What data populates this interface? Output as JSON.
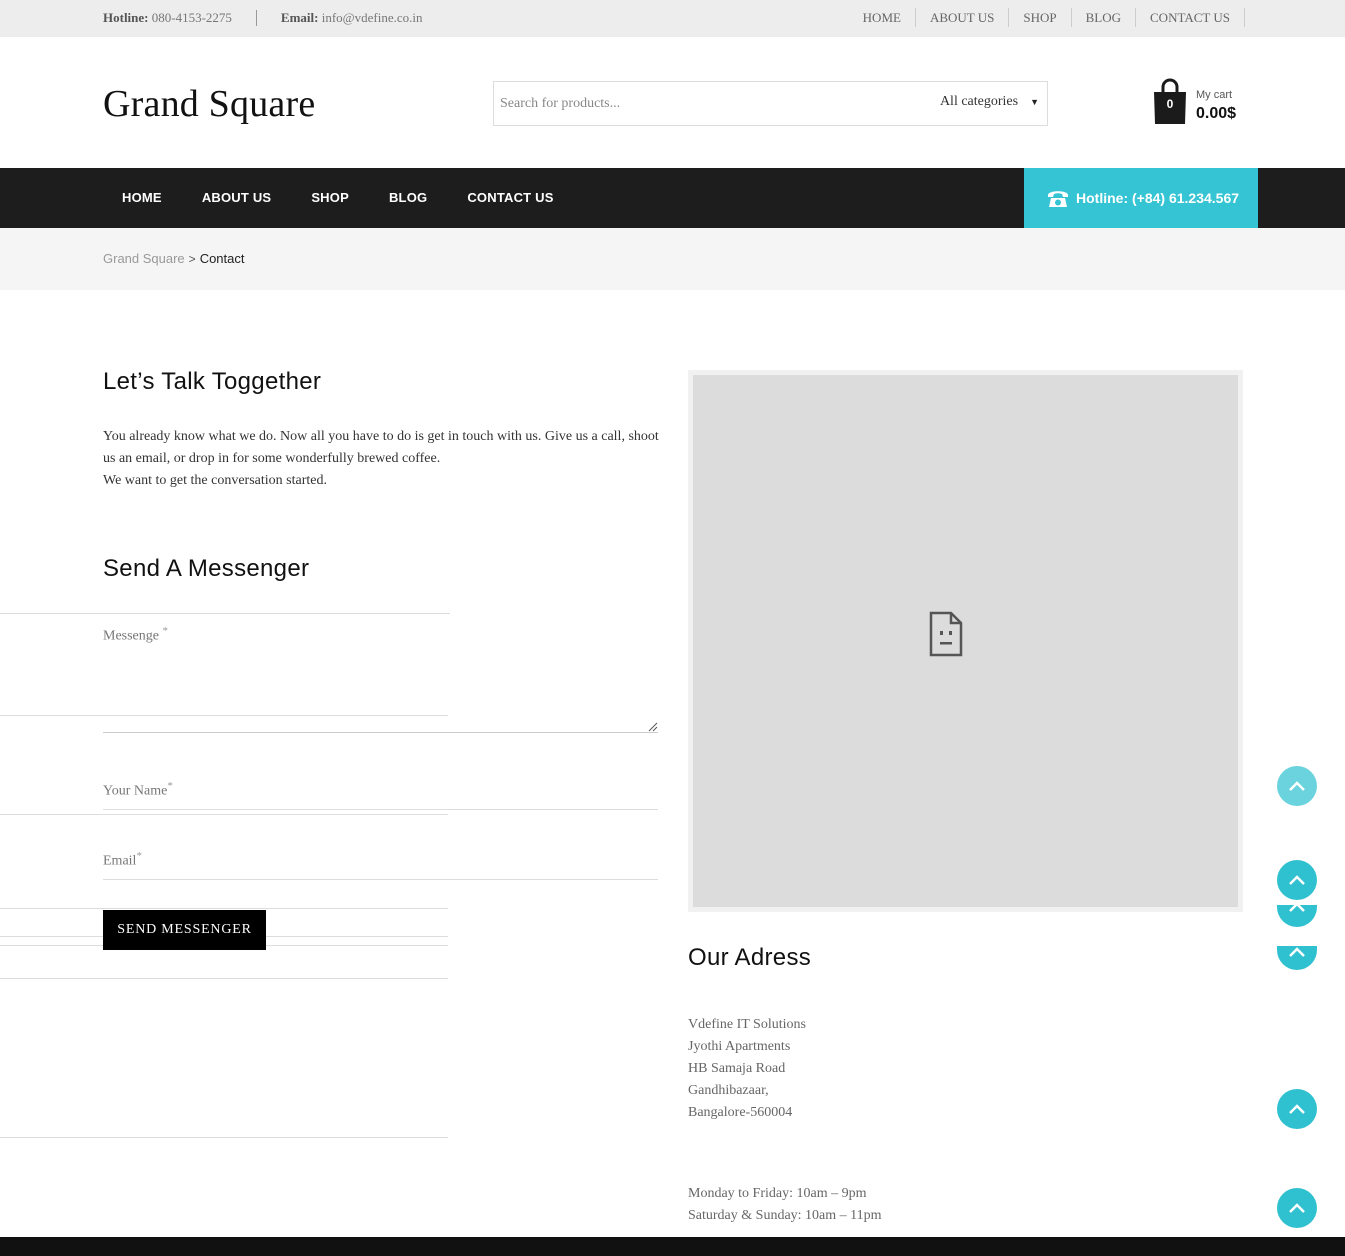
{
  "topbar": {
    "hotline_label": "Hotline:",
    "hotline_value": "080-4153-2275",
    "email_label": "Email:",
    "email_value": "info@vdefine.co.in",
    "nav": [
      "HOME",
      "ABOUT US",
      "SHOP",
      "BLOG",
      "CONTACT US"
    ]
  },
  "header": {
    "logo": "Grand Square",
    "search_placeholder": "Search for products...",
    "category": "All categories",
    "cart_count": "0",
    "cart_label": "My cart",
    "cart_total": "0.00$"
  },
  "mainnav": {
    "items": [
      "HOME",
      "ABOUT US",
      "SHOP",
      "BLOG",
      "CONTACT US"
    ],
    "hotline": "Hotline: (+84) 61.234.567"
  },
  "breadcrumb": {
    "home": "Grand Square",
    "separator": ">",
    "current": "Contact"
  },
  "intro": {
    "title": "Let’s Talk Toggether",
    "line1": "You already know what we do. Now all you have to do is get in touch with us. Give us a call, shoot us an email, or drop in for some wonderfully brewed coffee.",
    "line2": "We want to get the conversation started."
  },
  "form": {
    "title": "Send A Messenger",
    "message_label": "Messenge",
    "name_label": "Your Name",
    "email_label": "Email",
    "required_mark": "*",
    "submit": "SEND MESSENGER"
  },
  "address": {
    "title": "Our Adress",
    "lines": [
      "Vdefine IT Solutions",
      "Jyothi Apartments",
      "HB Samaja Road",
      "Gandhibazaar,",
      "Bangalore-560004"
    ]
  },
  "hours": {
    "lines": [
      "Monday to Friday: 10am – 9pm",
      "Saturday & Sunday: 10am – 11pm"
    ]
  },
  "colors": {
    "accent": "#35c4d3",
    "nav_bg": "#1d1d1d",
    "button_bg": "#000000"
  }
}
